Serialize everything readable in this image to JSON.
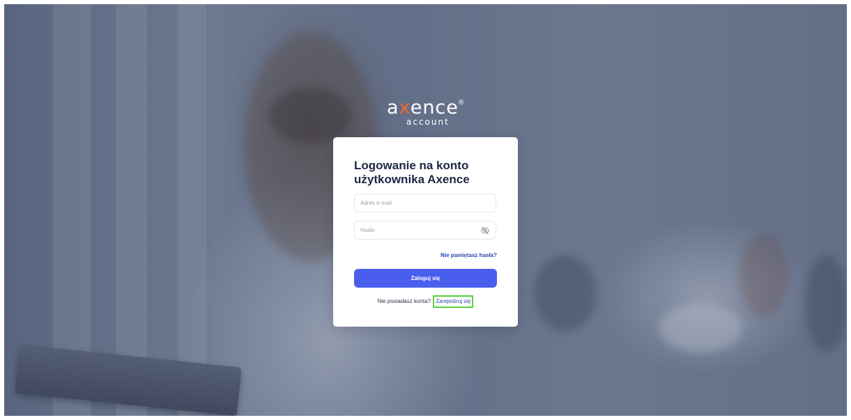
{
  "logo": {
    "main_prefix": "a",
    "main_x": "x",
    "main_suffix": "ence",
    "registered_mark": "®",
    "sub": "account",
    "accent_color": "#f2692a"
  },
  "login_card": {
    "title": "Logowanie na konto użytkownika Axence",
    "email_placeholder": "Adres e-mail",
    "email_value": "",
    "password_placeholder": "Hasło",
    "password_value": "",
    "password_toggle_icon": "eye-slash-icon",
    "forgot_password": "Nie pamiętasz hasła?",
    "login_button": "Zaloguj się",
    "no_account_text": "Nie posiadasz konta?",
    "register_link": "Zarejestruj się"
  },
  "colors": {
    "primary_button": "#4a5eee",
    "link": "#2f46b3",
    "title": "#1d2744",
    "highlight": "#57d33d"
  }
}
